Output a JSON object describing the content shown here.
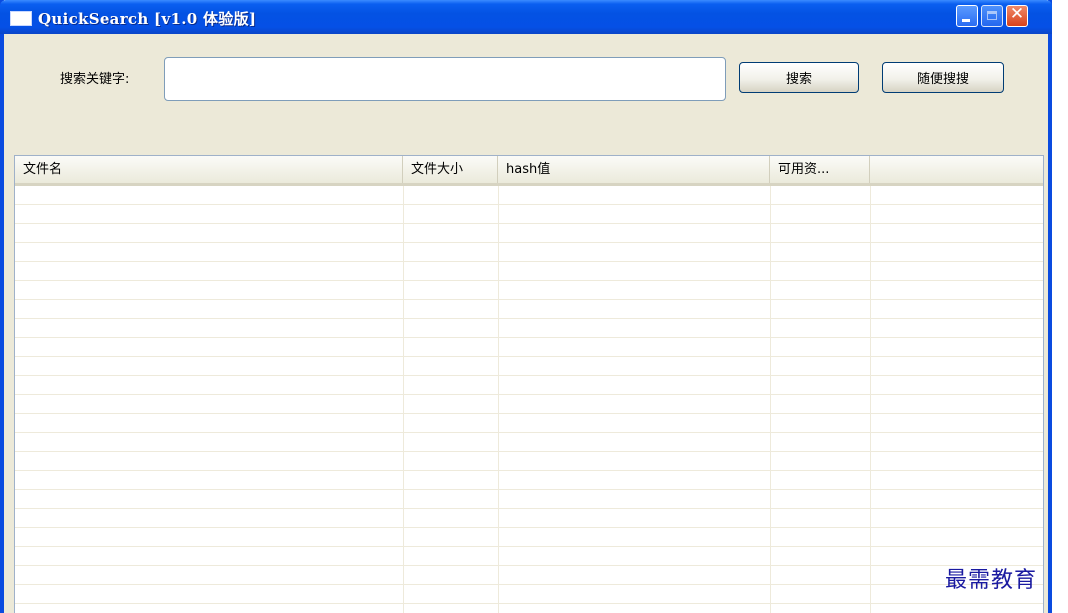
{
  "window": {
    "title": "QuickSearch [v1.0 体验版]",
    "icon": "app-window-icon",
    "buttons": {
      "minimize": "minimize-icon",
      "maximize": "maximize-icon",
      "close": "close-icon"
    },
    "close_glyph": "✕"
  },
  "search": {
    "label": "搜索关键字:",
    "value": "",
    "placeholder": ""
  },
  "buttons": {
    "search": "搜索",
    "random": "随便搜搜"
  },
  "list": {
    "columns": [
      "文件名",
      "文件大小",
      "hash值",
      "可用资...",
      ""
    ],
    "rows": []
  },
  "watermark": "最需教育",
  "colors": {
    "titlebar": "#0452e3",
    "window_bg": "#ece9d8",
    "border": "#0a4be0",
    "watermark": "#1a1aa0"
  }
}
